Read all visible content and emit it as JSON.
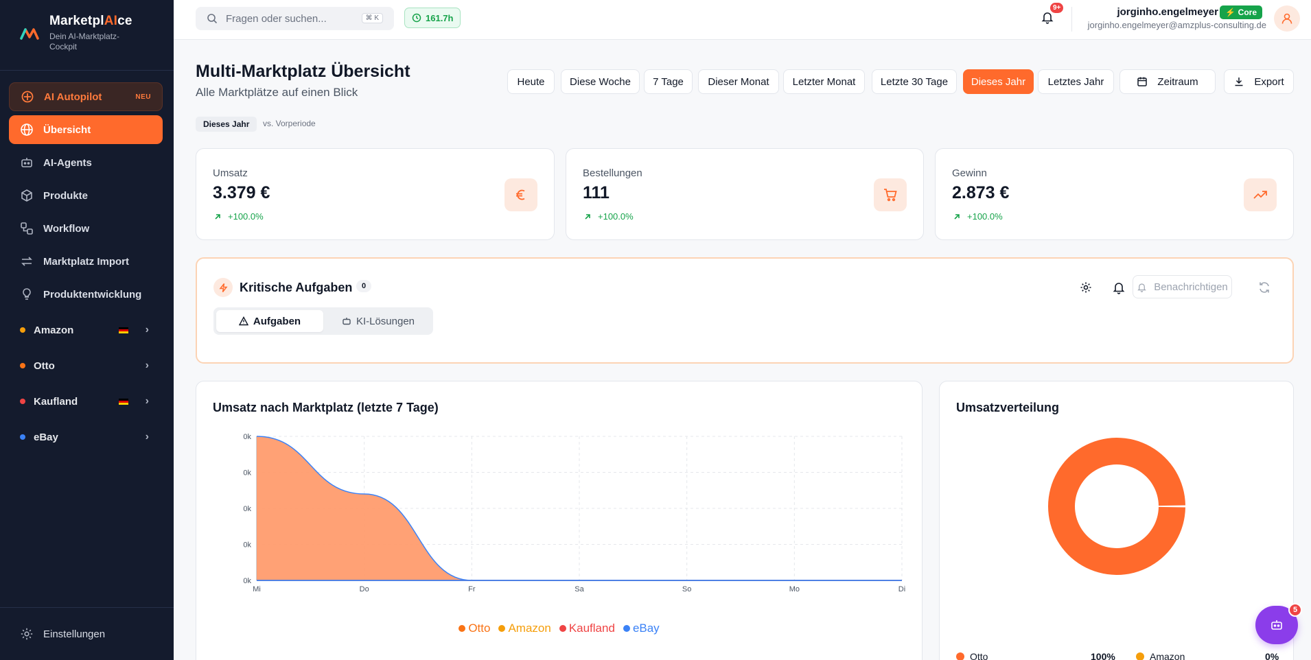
{
  "sidebar": {
    "brand_prefix": "Marketpl",
    "brand_ai": "AI",
    "brand_suffix": "ce",
    "brand_subtitle": "Dein AI-Marktplatz-Cockpit",
    "autopilot": {
      "label": "AI Autopilot",
      "badge": "NEU"
    },
    "nav": [
      {
        "label": "Übersicht",
        "icon": "globe-icon",
        "active": true
      },
      {
        "label": "AI-Agents",
        "icon": "bot-icon"
      },
      {
        "label": "Produkte",
        "icon": "package-icon"
      },
      {
        "label": "Workflow",
        "icon": "workflow-icon"
      },
      {
        "label": "Marktplatz Import",
        "icon": "arrows-icon"
      },
      {
        "label": "Produktentwicklung",
        "icon": "lightbulb-icon"
      }
    ],
    "marketplaces": [
      {
        "label": "Amazon",
        "color": "#f59e0b",
        "flag": true
      },
      {
        "label": "Otto",
        "color": "#f97316",
        "flag": false
      },
      {
        "label": "Kaufland",
        "color": "#ef4444",
        "flag": true
      },
      {
        "label": "eBay",
        "color": "#3b82f6",
        "flag": false
      }
    ],
    "settings_label": "Einstellungen"
  },
  "topbar": {
    "search_placeholder": "Fragen oder suchen...",
    "search_shortcut": "⌘ K",
    "timer": "161.7h",
    "notif_badge": "9+",
    "user_name": "jorginho.engelmeyer",
    "user_tier": "Core",
    "user_email": "jorginho.engelmeyer@amzplus-consulting.de"
  },
  "header": {
    "title": "Multi-Marktplatz Übersicht",
    "subtitle": "Alle Marktplätze auf einen Blick",
    "periods": [
      "Heute",
      "Diese Woche",
      "7 Tage",
      "Dieser Monat",
      "Letzter Monat",
      "Letzte 30 Tage",
      "Dieses Jahr",
      "Letztes Jahr"
    ],
    "active_period": "Dieses Jahr",
    "range_label": "Zeitraum",
    "export_label": "Export",
    "period_tag": "Dieses Jahr",
    "compare_label": "vs. Vorperiode"
  },
  "kpis": [
    {
      "label": "Umsatz",
      "value": "3.379 €",
      "trend": "+100.0%",
      "icon": "euro-icon"
    },
    {
      "label": "Bestellungen",
      "value": "111",
      "trend": "+100.0%",
      "icon": "cart-icon"
    },
    {
      "label": "Gewinn",
      "value": "2.873 €",
      "trend": "+100.0%",
      "icon": "trending-up-icon"
    }
  ],
  "tasks": {
    "title": "Kritische Aufgaben",
    "count": "0",
    "notify_label": "Benachrichtigen",
    "tabs": [
      "Aufgaben",
      "KI-Lösungen"
    ]
  },
  "revenue_card": {
    "title": "Umsatz nach Marktplatz (letzte 7 Tage)"
  },
  "distribution_card": {
    "title": "Umsatzverteilung",
    "legend": [
      {
        "label": "Otto",
        "value": "100%",
        "color": "#ff6a2c"
      },
      {
        "label": "Amazon",
        "value": "0%",
        "color": "#f59e0b"
      }
    ]
  },
  "chart_data": [
    {
      "type": "area",
      "title": "Umsatz nach Marktplatz (letzte 7 Tage)",
      "x": [
        "Mi",
        "Do",
        "Fr",
        "Sa",
        "So",
        "Mo",
        "Di"
      ],
      "y_tick_labels": [
        "0k",
        "0k",
        "0k",
        "0k",
        "0k"
      ],
      "ylim": [
        0,
        1
      ],
      "grid": true,
      "legend_position": "bottom",
      "series": [
        {
          "name": "Otto",
          "color": "#f97316",
          "values": [
            1,
            0.6,
            0,
            0,
            0,
            0,
            0
          ]
        },
        {
          "name": "Amazon",
          "color": "#f59e0b",
          "values": [
            0,
            0,
            0,
            0,
            0,
            0,
            0
          ]
        },
        {
          "name": "Kaufland",
          "color": "#ef4444",
          "values": [
            0,
            0,
            0,
            0,
            0,
            0,
            0
          ]
        },
        {
          "name": "eBay",
          "color": "#3b82f6",
          "values": [
            0,
            0,
            0,
            0,
            0,
            0,
            0
          ]
        }
      ]
    },
    {
      "type": "pie",
      "title": "Umsatzverteilung",
      "categories": [
        "Otto",
        "Amazon"
      ],
      "values": [
        100,
        0
      ],
      "colors": [
        "#ff6a2c",
        "#f59e0b"
      ]
    }
  ],
  "fab": {
    "badge": "5",
    "icon": "bot-icon"
  }
}
